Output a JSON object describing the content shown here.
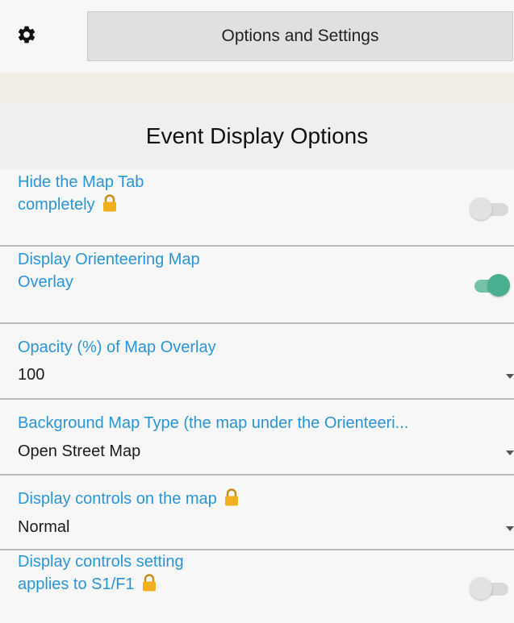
{
  "topbar": {
    "settings_icon": "gear-icon",
    "button_label": "Options and Settings"
  },
  "panel": {
    "title": "Event Display Options",
    "rows": [
      {
        "label_line1": "Hide the Map Tab",
        "label_line2": "completely",
        "locked": true,
        "toggle_on": false
      },
      {
        "label_line1": "Display Orienteering Map",
        "label_line2": "Overlay",
        "locked": false,
        "toggle_on": true
      },
      {
        "label": "Opacity (%) of Map Overlay",
        "value": "100"
      },
      {
        "label": "Background Map Type (the map under the Orienteeri...",
        "value": "Open Street Map"
      },
      {
        "label": "Display controls on the map",
        "locked": true,
        "value": "Normal"
      },
      {
        "label_line1": "Display controls setting",
        "label_line2": "applies to S1/F1",
        "locked": true,
        "toggle_on": false
      }
    ]
  },
  "colors": {
    "label_blue": "#2a95d6",
    "toggle_on": "#4aae90",
    "lock_gold": "#f2b01e"
  }
}
